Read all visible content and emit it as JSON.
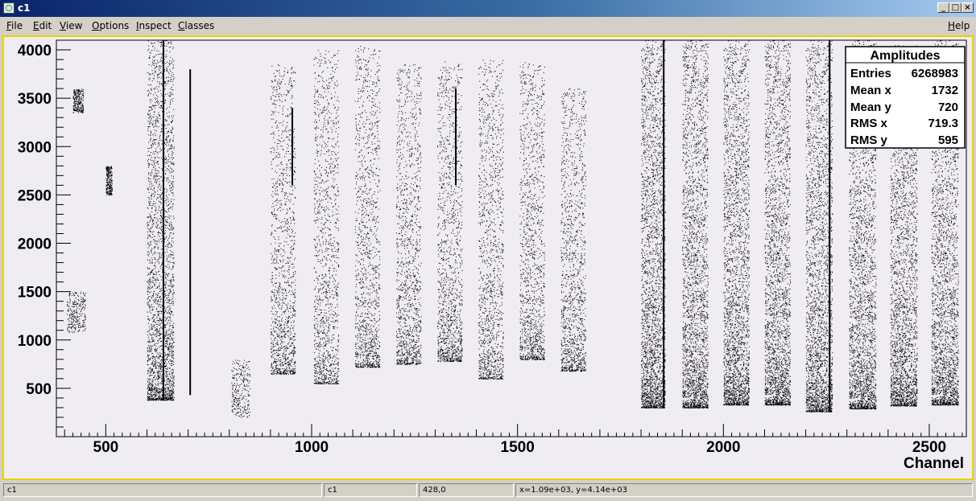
{
  "window": {
    "title": "c1",
    "btn_minimize": "_",
    "btn_maximize": "□",
    "btn_close": "×"
  },
  "menubar": {
    "items": [
      {
        "key": "F",
        "rest": "ile"
      },
      {
        "key": "E",
        "rest": "dit"
      },
      {
        "key": "V",
        "rest": "iew"
      },
      {
        "key": "O",
        "rest": "ptions"
      },
      {
        "key": "I",
        "rest": "nspect"
      },
      {
        "key": "C",
        "rest": "lasses"
      }
    ],
    "help": {
      "key": "H",
      "rest": "elp"
    }
  },
  "stats_box": {
    "title": "Amplitudes",
    "rows": [
      {
        "label": "Entries",
        "value": "6268983"
      },
      {
        "label": "Mean x",
        "value": "1732"
      },
      {
        "label": "Mean y",
        "value": "720"
      },
      {
        "label": "RMS x",
        "value": "719.3"
      },
      {
        "label": "RMS y",
        "value": "595"
      }
    ]
  },
  "statusbar": {
    "canvas_name": "c1",
    "object_name": "c1",
    "bin_info": "428,0",
    "coords": "x=1.09e+03, y=4.14e+03"
  },
  "chart_data": {
    "type": "scatter",
    "title": "",
    "xlabel": "Channel",
    "ylabel": "",
    "xlim": [
      380,
      2590
    ],
    "ylim": [
      0,
      4100
    ],
    "x_ticks": [
      500,
      1000,
      1500,
      2000,
      2500
    ],
    "y_ticks": [
      500,
      1000,
      1500,
      2000,
      2500,
      3000,
      3500,
      4000
    ],
    "grid": false,
    "legend": "none",
    "point_color": "#000000",
    "bands": [
      {
        "x_from": 600,
        "x_to": 665,
        "y_from": 380,
        "y_to": 4100,
        "density": "dense"
      },
      {
        "x_from": 900,
        "x_to": 960,
        "y_from": 650,
        "y_to": 3850,
        "density": "medium"
      },
      {
        "x_from": 1005,
        "x_to": 1065,
        "y_from": 550,
        "y_to": 4000,
        "density": "medium"
      },
      {
        "x_from": 1105,
        "x_to": 1165,
        "y_from": 720,
        "y_to": 4050,
        "density": "medium"
      },
      {
        "x_from": 1205,
        "x_to": 1265,
        "y_from": 750,
        "y_to": 3850,
        "density": "medium"
      },
      {
        "x_from": 1305,
        "x_to": 1365,
        "y_from": 780,
        "y_to": 3880,
        "density": "medium"
      },
      {
        "x_from": 1405,
        "x_to": 1465,
        "y_from": 600,
        "y_to": 3900,
        "density": "medium"
      },
      {
        "x_from": 1505,
        "x_to": 1565,
        "y_from": 800,
        "y_to": 3880,
        "density": "medium"
      },
      {
        "x_from": 1605,
        "x_to": 1665,
        "y_from": 680,
        "y_to": 3600,
        "density": "medium"
      },
      {
        "x_from": 1800,
        "x_to": 1858,
        "y_from": 300,
        "y_to": 4100,
        "density": "dense"
      },
      {
        "x_from": 1900,
        "x_to": 1962,
        "y_from": 300,
        "y_to": 4100,
        "density": "dense"
      },
      {
        "x_from": 2000,
        "x_to": 2062,
        "y_from": 330,
        "y_to": 4100,
        "density": "dense"
      },
      {
        "x_from": 2100,
        "x_to": 2162,
        "y_from": 330,
        "y_to": 4100,
        "density": "dense"
      },
      {
        "x_from": 2200,
        "x_to": 2264,
        "y_from": 260,
        "y_to": 4100,
        "density": "dense"
      },
      {
        "x_from": 2305,
        "x_to": 2370,
        "y_from": 290,
        "y_to": 4100,
        "density": "dense"
      },
      {
        "x_from": 2405,
        "x_to": 2470,
        "y_from": 320,
        "y_to": 4050,
        "density": "dense"
      },
      {
        "x_from": 2505,
        "x_to": 2570,
        "y_from": 330,
        "y_to": 4100,
        "density": "dense"
      }
    ],
    "lines": [
      {
        "x": 640,
        "y_from": 380,
        "y_to": 4100
      },
      {
        "x": 705,
        "y_from": 430,
        "y_to": 3800
      },
      {
        "x": 953,
        "y_from": 2600,
        "y_to": 3400
      },
      {
        "x": 1350,
        "y_from": 2600,
        "y_to": 3600
      },
      {
        "x": 1855,
        "y_from": 300,
        "y_to": 4100
      },
      {
        "x": 2258,
        "y_from": 260,
        "y_to": 4100
      }
    ],
    "clusters": [
      {
        "x_from": 405,
        "x_to": 450,
        "y_from": 1080,
        "y_to": 1500
      },
      {
        "x_from": 420,
        "x_to": 445,
        "y_from": 3350,
        "y_to": 3600
      },
      {
        "x_from": 500,
        "x_to": 515,
        "y_from": 2500,
        "y_to": 2800
      },
      {
        "x_from": 805,
        "x_to": 850,
        "y_from": 200,
        "y_to": 800
      }
    ]
  }
}
